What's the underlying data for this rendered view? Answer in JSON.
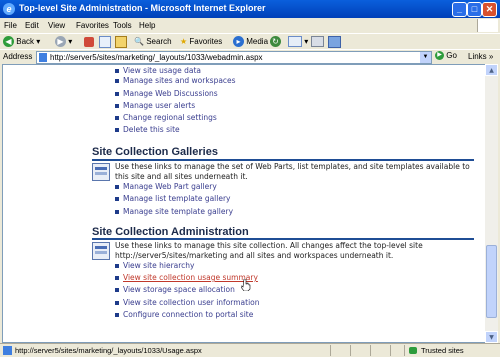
{
  "window": {
    "title": "Top-level Site Administration - Microsoft Internet Explorer"
  },
  "menu": [
    "File",
    "Edit",
    "View",
    "Favorites",
    "Tools",
    "Help"
  ],
  "toolbar": {
    "back": "Back",
    "search": "Search",
    "favorites": "Favorites",
    "media": "Media"
  },
  "address": {
    "label": "Address",
    "url": "http://server5/sites/marketing/_layouts/1033/webadmin.aspx",
    "go": "Go",
    "links": "Links"
  },
  "top_links": [
    "View site usage data",
    "Manage sites and workspaces",
    "Manage Web Discussions",
    "Manage user alerts",
    "Change regional settings",
    "Delete this site"
  ],
  "galleries": {
    "title": "Site Collection Galleries",
    "description": "Use these links to manage the set of Web Parts, list templates, and site templates available to this site and all sites underneath it.",
    "links": [
      "Manage Web Part gallery",
      "Manage list template gallery",
      "Manage site template gallery"
    ]
  },
  "admin": {
    "title": "Site Collection Administration",
    "description": "Use these links to manage this site collection. All changes affect the top-level site http://server5/sites/marketing and all sites and workspaces underneath it.",
    "links": [
      "View site hierarchy",
      "View site collection usage summary",
      "View storage space allocation",
      "View site collection user information",
      "Configure connection to portal site"
    ]
  },
  "status": {
    "text": "http://server5/sites/marketing/_layouts/1033/Usage.aspx",
    "zone": "Trusted sites"
  }
}
